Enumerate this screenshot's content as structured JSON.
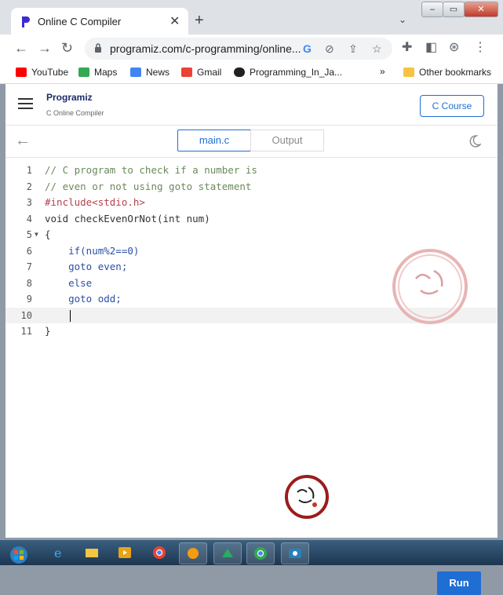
{
  "browser": {
    "tab_title": "Online C Compiler",
    "url": "programiz.com/c-programming/online...",
    "bookmarks": [
      "YouTube",
      "Maps",
      "News",
      "Gmail",
      "Programming_In_Ja...",
      "Other bookmarks"
    ]
  },
  "header": {
    "logo_text": "Programiz",
    "subtitle": "C Online Compiler",
    "course_button": "C Course"
  },
  "editor_tabs": [
    "main.c",
    "Output"
  ],
  "code_lines": [
    "// C program to check if a number is",
    "// even or not using goto statement",
    "#include<stdio.h>",
    "void checkEvenOrNot(int num)",
    "{",
    "    if(num%2==0)",
    "    goto even;",
    "    else",
    "    goto odd;",
    "",
    "}"
  ],
  "active_line": 10,
  "run_button": "Run",
  "colors": {
    "accent": "#1f6ed4",
    "comment": "#6a8a5a",
    "keyword": "#2b4fa8",
    "string": "#b5404b"
  }
}
